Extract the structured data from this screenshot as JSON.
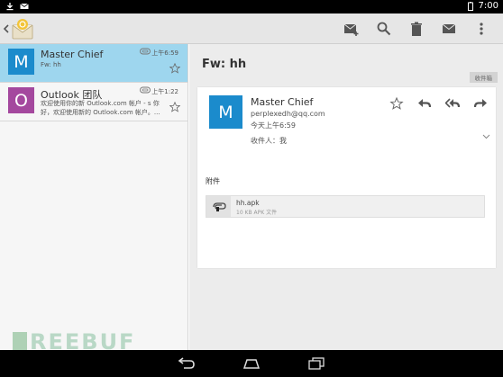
{
  "status_bar": {
    "time": "7:00"
  },
  "toolbar": {
    "actions": [
      {
        "name": "compose-icon"
      },
      {
        "name": "search-icon"
      },
      {
        "name": "delete-icon"
      },
      {
        "name": "mail-icon"
      },
      {
        "name": "overflow-menu-icon"
      }
    ]
  },
  "messages": [
    {
      "avatar_letter": "M",
      "avatar_color": "#1b8bcc",
      "sender": "Master Chief",
      "snippet": "Fw: hh",
      "time": "上午6:59",
      "selected": true
    },
    {
      "avatar_letter": "O",
      "avatar_color": "#a4489e",
      "sender": "Outlook 团队",
      "snippet": "欢迎使用你的新 Outlook.com 帐户 - s 你好，欢迎使用新的 Outlook.com 帐户。...",
      "time": "上午1:22",
      "selected": false
    }
  ],
  "detail": {
    "subject": "Fw: hh",
    "folder_tag": "收件箱",
    "avatar_letter": "M",
    "from_name": "Master Chief",
    "from_email": "perplexedh@qq.com",
    "date": "今天上午6:59",
    "to": "收件人：我",
    "attachments_title": "附件",
    "attachment": {
      "name": "hh.apk",
      "size": "10 KB APK 文件"
    }
  },
  "watermark": {
    "text": "REEBUF"
  },
  "colors": {
    "accent": "#1b8bcc",
    "selected_row": "#9ed6ee",
    "outlook_avatar": "#a4489e"
  }
}
